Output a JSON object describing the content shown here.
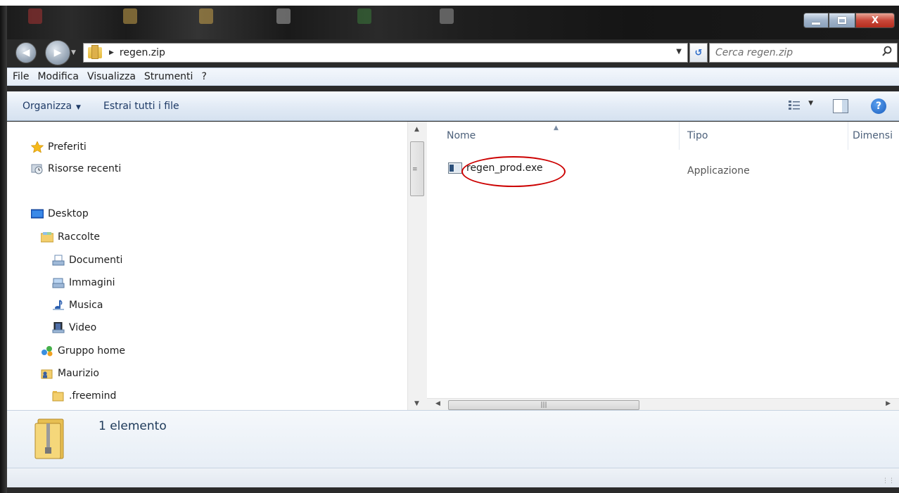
{
  "window": {
    "caption_minimize": "minimize",
    "caption_maximize": "maximize",
    "caption_close": "X"
  },
  "address_bar": {
    "path_segments": [
      "regen.zip"
    ],
    "search_placeholder": "Cerca regen.zip"
  },
  "menu": {
    "items": [
      "File",
      "Modifica",
      "Visualizza",
      "Strumenti",
      "?"
    ]
  },
  "toolbar": {
    "organize_label": "Organizza",
    "extract_label": "Estrai tutti i file"
  },
  "nav_pane": {
    "items": [
      {
        "label": "Preferiti",
        "icon": "star-icon"
      },
      {
        "label": "Risorse recenti",
        "icon": "recent-places-icon"
      },
      {
        "label": "Desktop",
        "icon": "desktop-icon"
      },
      {
        "label": "Raccolte",
        "icon": "libraries-icon"
      },
      {
        "label": "Documenti",
        "icon": "documents-icon"
      },
      {
        "label": "Immagini",
        "icon": "pictures-icon"
      },
      {
        "label": "Musica",
        "icon": "music-icon"
      },
      {
        "label": "Video",
        "icon": "video-icon"
      },
      {
        "label": "Gruppo home",
        "icon": "homegroup-icon"
      },
      {
        "label": "Maurizio",
        "icon": "user-folder-icon"
      },
      {
        "label": ".freemind",
        "icon": "folder-icon"
      }
    ]
  },
  "file_list": {
    "columns": [
      "Nome",
      "Tipo",
      "Dimensi"
    ],
    "rows": [
      {
        "name": "regen_prod.exe",
        "type": "Applicazione",
        "icon": "exe-icon"
      }
    ],
    "annotation_color": "#cc0000"
  },
  "details": {
    "count_text": "1 elemento",
    "icon": "zip-folder-icon"
  },
  "colors": {
    "accent": "#1e3a66",
    "command_bar": "#dde7f3",
    "close_button": "#c9483a"
  }
}
